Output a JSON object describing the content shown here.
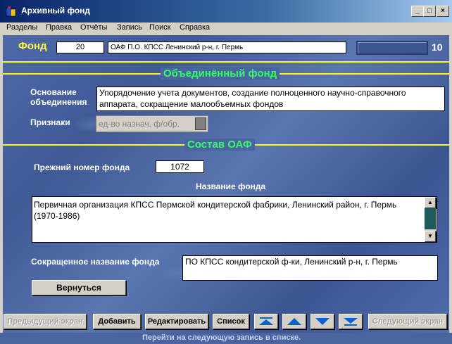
{
  "window": {
    "title": "Архивный фонд",
    "minimize": "_",
    "maximize": "□",
    "close": "×"
  },
  "menu": [
    "Разделы",
    "Правка",
    "Отчёты",
    "Запись",
    "Поиск",
    "Справка"
  ],
  "fond": {
    "label": "Фонд",
    "number": "20",
    "name": "ОАФ П.О. КПСС Ленинский р-н, г. Пермь",
    "count": "10"
  },
  "merged": {
    "section_title": "Объединённый фонд",
    "basis_label": "Основание объединения",
    "basis_value": "Упорядочение учета документов, создание полноценного научно-справочного аппарата, сокращение малообъемных фондов",
    "signs_label": "Признаки",
    "signs_value": "ед-во назнач. ф/обр."
  },
  "composition": {
    "section_title": "Состав ОАФ",
    "prev_number_label": "Прежний номер фонда",
    "prev_number_value": "1072",
    "fond_name_label": "Название фонда",
    "fond_name_value": "Первичная организация КПСС Пермской кондитерской фабрики, Ленинский район, г. Пермь (1970-1986)",
    "short_name_label": "Сокращенное название фонда",
    "short_name_value": "ПО КПСС кондитерской ф-ки, Ленинский р-н, г. Пермь",
    "back_button": "Вернуться"
  },
  "toolbar": {
    "prev_screen": "Предыдущий экран",
    "add": "Добавить",
    "edit": "Редактировать",
    "list": "Список",
    "next_screen": "Следующий экран"
  },
  "status": "Перейти на следующую запись в списке.",
  "colors": {
    "accent_yellow": "#ffff33",
    "section_green": "#33ff66",
    "background_blue": "#4a64a0"
  }
}
